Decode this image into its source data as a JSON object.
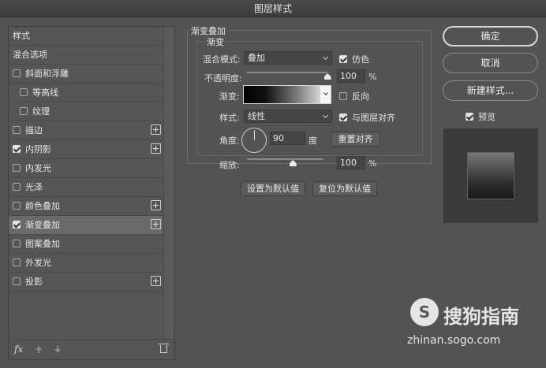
{
  "window": {
    "title": "图层样式"
  },
  "style_list": {
    "items": [
      {
        "label": "样式",
        "checkbox": false,
        "checked": false,
        "plus": false,
        "indent": false,
        "selected": false
      },
      {
        "label": "混合选项",
        "checkbox": false,
        "checked": false,
        "plus": false,
        "indent": false,
        "selected": false
      },
      {
        "label": "斜面和浮雕",
        "checkbox": true,
        "checked": false,
        "plus": false,
        "indent": false,
        "selected": false
      },
      {
        "label": "等高线",
        "checkbox": true,
        "checked": false,
        "plus": false,
        "indent": true,
        "selected": false
      },
      {
        "label": "纹理",
        "checkbox": true,
        "checked": false,
        "plus": false,
        "indent": true,
        "selected": false
      },
      {
        "label": "描边",
        "checkbox": true,
        "checked": false,
        "plus": true,
        "indent": false,
        "selected": false
      },
      {
        "label": "内阴影",
        "checkbox": true,
        "checked": true,
        "plus": true,
        "indent": false,
        "selected": false
      },
      {
        "label": "内发光",
        "checkbox": true,
        "checked": false,
        "plus": false,
        "indent": false,
        "selected": false
      },
      {
        "label": "光泽",
        "checkbox": true,
        "checked": false,
        "plus": false,
        "indent": false,
        "selected": false
      },
      {
        "label": "颜色叠加",
        "checkbox": true,
        "checked": false,
        "plus": true,
        "indent": false,
        "selected": false
      },
      {
        "label": "渐变叠加",
        "checkbox": true,
        "checked": true,
        "plus": true,
        "indent": false,
        "selected": true
      },
      {
        "label": "图案叠加",
        "checkbox": true,
        "checked": false,
        "plus": false,
        "indent": false,
        "selected": false
      },
      {
        "label": "外发光",
        "checkbox": true,
        "checked": false,
        "plus": false,
        "indent": false,
        "selected": false
      },
      {
        "label": "投影",
        "checkbox": true,
        "checked": false,
        "plus": true,
        "indent": false,
        "selected": false
      }
    ],
    "fx_label": "fx"
  },
  "gradient_overlay": {
    "group_title": "渐变叠加",
    "section_title": "渐变",
    "blend_mode_label": "混合模式:",
    "blend_mode_value": "叠加",
    "dither_label": "仿色",
    "dither_checked": true,
    "opacity_label": "不透明度:",
    "opacity_value": "100",
    "opacity_unit": "%",
    "opacity_level": 1.0,
    "gradient_label": "渐变:",
    "reverse_label": "反向",
    "reverse_checked": false,
    "style_label": "样式:",
    "style_value": "线性",
    "align_label": "与图层对齐",
    "align_checked": true,
    "angle_label": "角度:",
    "angle_value": "90",
    "angle_unit": "度",
    "reset_align_button": "重置对齐",
    "scale_label": "缩放:",
    "scale_value": "100",
    "scale_unit": "%",
    "scale_level": 0.6,
    "set_default_button": "设置为默认值",
    "reset_default_button": "复位为默认值"
  },
  "buttons": {
    "ok": "确定",
    "cancel": "取消",
    "new_style": "新建样式...",
    "preview_label": "预览",
    "preview_checked": true
  },
  "watermark": {
    "text": "搜狗指南",
    "url": "zhinan.sogo.com",
    "logo_letter": "S"
  }
}
